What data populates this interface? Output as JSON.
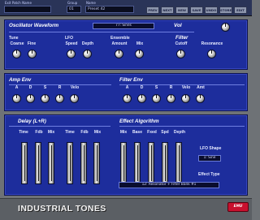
{
  "header": {
    "patch_label": "Exit Patch Name",
    "patch_value": "",
    "group_label": "Group",
    "group_value": "01",
    "name_label": "Name",
    "name_value": "Preset 42",
    "buttons": [
      "PREV",
      "NEXT",
      "NEW",
      "SAVE",
      "UNDO",
      "STORE",
      "EDIT"
    ]
  },
  "oscillator": {
    "title": "Oscillator Waveform",
    "waveform": "77: Sines",
    "vol_label": "Vol",
    "tune": {
      "title": "Tune",
      "coarse": "Coarse",
      "fine": "Fine"
    },
    "lfo": {
      "title": "LFO",
      "speed": "Speed",
      "depth": "Depth"
    },
    "ensemble": {
      "title": "Ensemble",
      "amount": "Amount",
      "mix": "Mix"
    },
    "filter": {
      "title": "Filter",
      "cutoff": "Cutoff",
      "resonance": "Resonance"
    }
  },
  "amp_env": {
    "title": "Amp Env",
    "labels": [
      "A",
      "D",
      "S",
      "R",
      "Velo"
    ]
  },
  "filter_env": {
    "title": "Filter Env",
    "labels": [
      "A",
      "D",
      "S",
      "R",
      "Velo",
      "Amt"
    ]
  },
  "delay": {
    "title": "Delay (L+R)",
    "left_labels": [
      "Time",
      "Fdb",
      "Mix"
    ],
    "right_labels": [
      "Time",
      "Fdb",
      "Mix"
    ]
  },
  "effect": {
    "title": "Effect Algorithm",
    "labels": [
      "Mix",
      "Base",
      "Fxed",
      "Spd",
      "Depth"
    ],
    "lfo_shape_label": "LFO Shape",
    "lfo_shape_value": "1: Sine",
    "effect_type_label": "Effect Type",
    "effect_type_value": "12: Resonator + Filter Bank #1"
  },
  "footer": {
    "product_name": "INDUSTRIAL TONES",
    "logo_text": "EMU"
  }
}
